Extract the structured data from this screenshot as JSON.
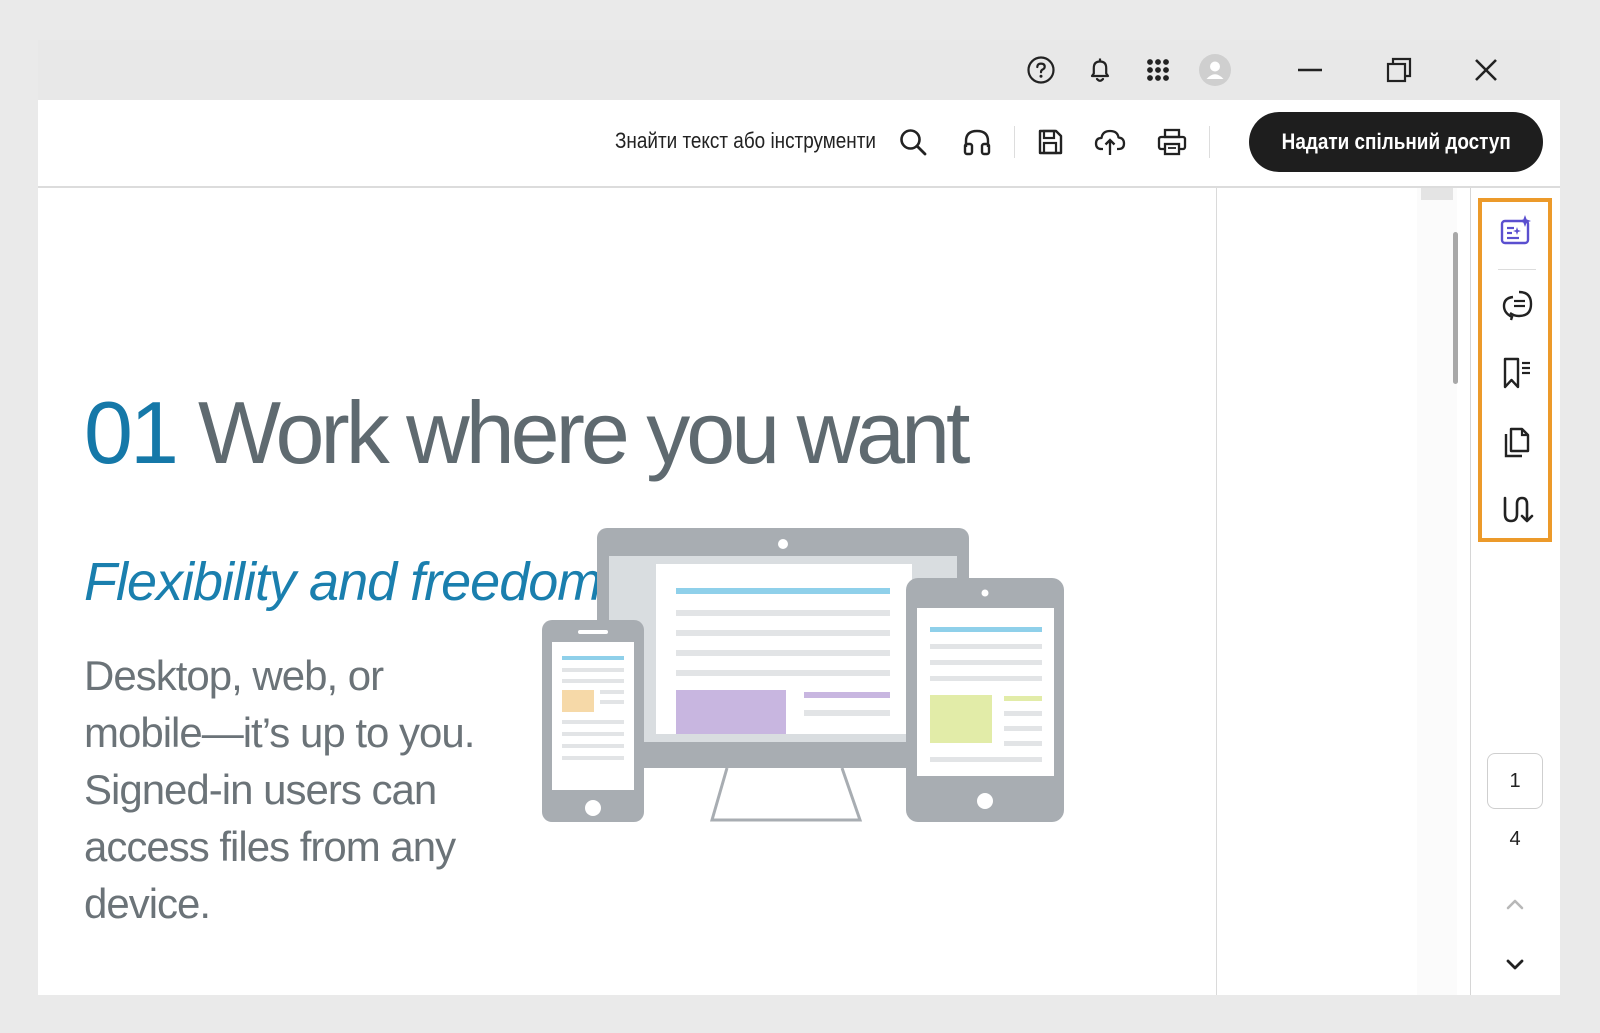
{
  "toolbar": {
    "search_label": "Знайти текст або інструменти",
    "share_label": "Надати спільний доступ"
  },
  "document": {
    "heading_number": "01",
    "heading_title": "Work where you want",
    "subheading": "Flexibility and freedom",
    "body_lines": [
      "Desktop, web, or",
      "mobile—it’s up to you.",
      "Signed-in users can",
      "access files from any",
      "device."
    ]
  },
  "page_nav": {
    "current_page": "1",
    "total_pages": "4"
  },
  "icons": {
    "titlebar": [
      "help-icon",
      "notification-bell-icon",
      "apps-grid-icon",
      "user-avatar-icon",
      "minimize-icon",
      "restore-icon",
      "close-icon"
    ],
    "toolbar": [
      "search-icon",
      "read-aloud-headphones-icon",
      "save-icon",
      "upload-cloud-icon",
      "print-icon"
    ],
    "right_rail": [
      "ai-assistant-icon",
      "comment-icon",
      "bookmarks-icon",
      "pages-icon",
      "attachments-icon"
    ]
  },
  "colors": {
    "accent_blue": "#1578a8",
    "rail_highlight": "#ec9a2a",
    "share_button": "#1e1e1e",
    "ai_icon": "#5a4fcf"
  }
}
